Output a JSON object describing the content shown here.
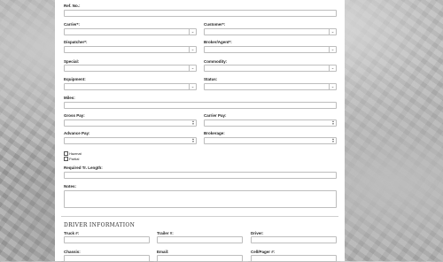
{
  "form": {
    "ref_no_label": "Ref. No.:",
    "carrier_label": "Carrier*:",
    "customer_label": "Customer*:",
    "dispatcher_label": "Dispatcher*:",
    "broker_label": "Broker/Agent*:",
    "special_label": "Special:",
    "commodity_label": "Commodity:",
    "equipment_label": "Equipment:",
    "status_label": "Status:",
    "miles_label": "Miles:",
    "gross_pay_label": "Gross Pay:",
    "carrier_pay_label": "Carrier Pay:",
    "advance_pay_label": "Advance Pay:",
    "brokerage_label": "Brokerage:",
    "hazmat_label": "Hazmat",
    "partial_label": "Partial",
    "required_length_label": "Required Tr. Length:",
    "notes_label": "Notes:"
  },
  "driver_section": {
    "title": "DRIVER INFORMATION",
    "truck_label": "Truck #:",
    "trailer_label": "Trailer #:",
    "driver_label": "Driver:",
    "chassis_label": "Chassis:",
    "email_label": "Email:",
    "cell_label": "Cell/Pager #:"
  },
  "icons": {
    "select_arrow": "chevron-down-icon",
    "spinner": "number-spinner-icon"
  }
}
